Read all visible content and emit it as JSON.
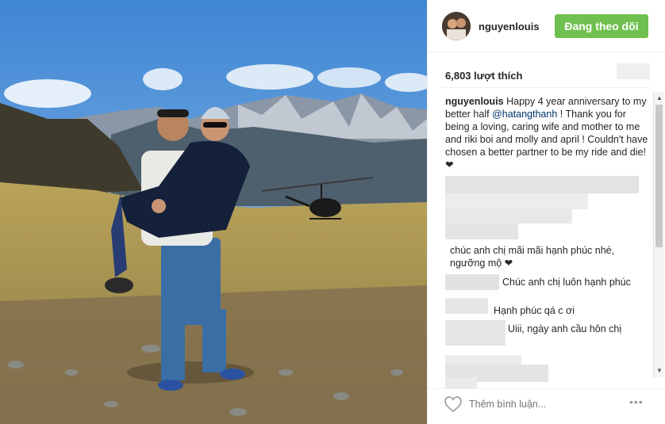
{
  "header": {
    "username": "nguyenlouis",
    "follow_label": "Đang theo dõi"
  },
  "likes": "6,803 lượt thích",
  "caption": {
    "username": "nguyenlouis",
    "text_before": "Happy 4 year anniversary to my better half",
    "mention": "@hatangthanh",
    "text_after": "! Thank you for being a loving, caring wife and mother to me and riki boi and molly and april ! Couldn't have chosen a better partner to be my ride and die! ❤"
  },
  "comments": [
    {
      "username": "",
      "text": "chúc anh chị mãi mãi hạnh phúc nhé, ngưỡng mộ ❤"
    },
    {
      "username": "",
      "text": "Chúc anh chị luôn hạnh phúc"
    },
    {
      "username": "",
      "text": "Hạnh phúc qá c ơi"
    },
    {
      "username": "",
      "text": "Uiii, ngày anh cầu hôn chị"
    }
  ],
  "footer": {
    "add_comment_placeholder": "Thêm bình luận...",
    "more_label": "•••"
  },
  "colors": {
    "follow_button": "#70c050",
    "link": "#003569",
    "blur": "#e6e6e6"
  },
  "icons": [
    "heart-icon",
    "more-options-icon",
    "scroll-up-icon",
    "scroll-down-icon"
  ]
}
